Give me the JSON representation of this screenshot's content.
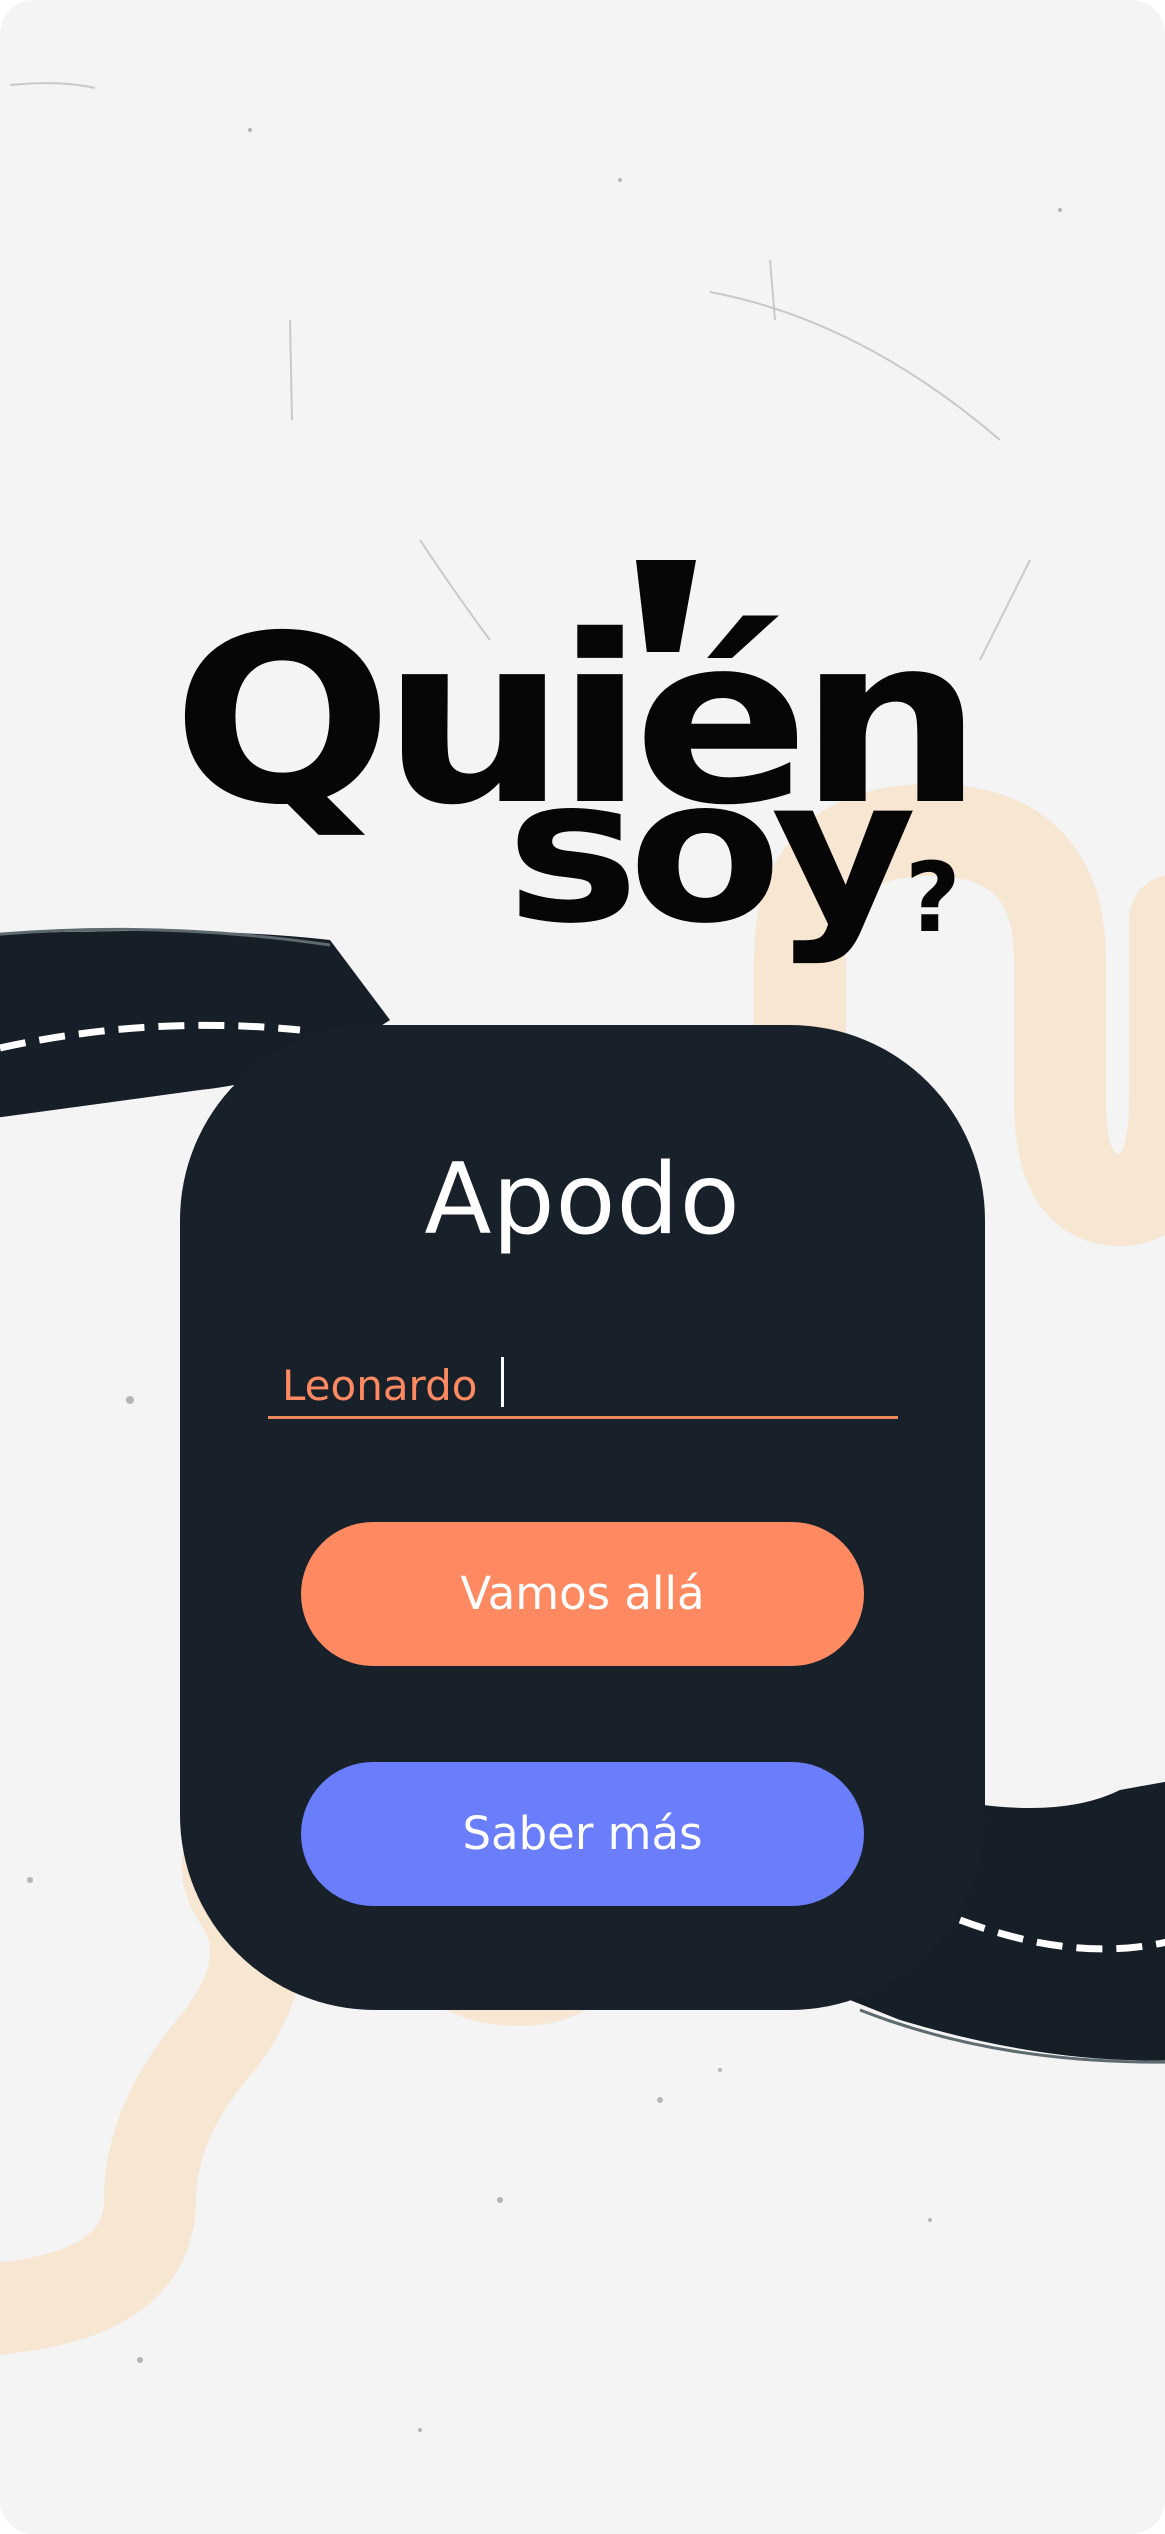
{
  "title": {
    "word1": "Quién",
    "word2": "soy",
    "question_mark": "?"
  },
  "card": {
    "heading": "Apodo",
    "input": {
      "value": "Leonardo",
      "placeholder": ""
    },
    "primary_button": "Vamos allá",
    "secondary_button": "Saber más"
  },
  "colors": {
    "background": "#f4f4f4",
    "card": "#18202a",
    "accent_orange": "#ff8a62",
    "accent_blue": "#6a7dfb",
    "squiggle": "#f6e6d2",
    "road": "#161e27",
    "title": "#060606"
  },
  "icons": [
    "road-decoration",
    "squiggle-decoration",
    "text-caret"
  ]
}
